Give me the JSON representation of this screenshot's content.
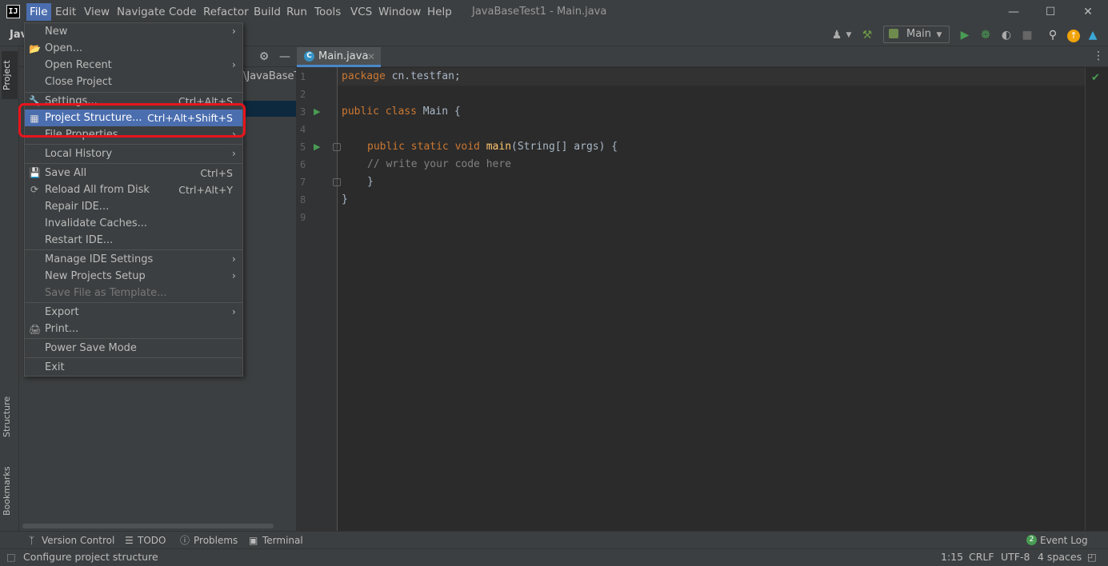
{
  "app": {
    "logo": "IJ",
    "window_title": "JavaBaseTest1 - Main.java"
  },
  "menubar": [
    {
      "label": "File"
    },
    {
      "label": "Edit"
    },
    {
      "label": "View"
    },
    {
      "label": "Navigate"
    },
    {
      "label": "Code"
    },
    {
      "label": "Refactor"
    },
    {
      "label": "Build"
    },
    {
      "label": "Run"
    },
    {
      "label": "Tools"
    },
    {
      "label": "VCS"
    },
    {
      "label": "Window"
    },
    {
      "label": "Help"
    }
  ],
  "window_controls": {
    "minimize": "—",
    "maximize": "☐",
    "close": "✕"
  },
  "toolbar": {
    "run_config": "Main"
  },
  "left_strip": {
    "project": "Project",
    "structure": "Structure",
    "bookmarks": "Bookmarks"
  },
  "project_panel": {
    "header_label": "Jav",
    "path_fragment": "\\JavaBaseT"
  },
  "editor": {
    "tab_label": "Main.java",
    "tab_icon": "C",
    "lines": [
      {
        "no": "1"
      },
      {
        "no": "2"
      },
      {
        "no": "3"
      },
      {
        "no": "4"
      },
      {
        "no": "5"
      },
      {
        "no": "6"
      },
      {
        "no": "7"
      },
      {
        "no": "8"
      },
      {
        "no": "9"
      }
    ],
    "code": {
      "l1_kw": "package",
      "l1_rest": " cn.testfan;",
      "l3_kw": "public class",
      "l3_rest": " Main {",
      "l5_kw": "public static void",
      "l5_fn": "main",
      "l5_rest": "(String[] args) {",
      "l6_comment": "// write your code here",
      "l7": "}",
      "l8": "}"
    }
  },
  "file_menu": {
    "new": "New",
    "open": "Open...",
    "open_recent": "Open Recent",
    "close_project": "Close Project",
    "settings": "Settings...",
    "settings_shortcut": "Ctrl+Alt+S",
    "project_structure": "Project Structure...",
    "project_structure_shortcut": "Ctrl+Alt+Shift+S",
    "file_properties": "File Properties",
    "local_history": "Local History",
    "save_all": "Save All",
    "save_all_shortcut": "Ctrl+S",
    "reload": "Reload All from Disk",
    "reload_shortcut": "Ctrl+Alt+Y",
    "repair": "Repair IDE...",
    "invalidate": "Invalidate Caches...",
    "restart": "Restart IDE...",
    "manage_settings": "Manage IDE Settings",
    "new_projects_setup": "New Projects Setup",
    "save_template": "Save File as Template...",
    "export": "Export",
    "print": "Print...",
    "power_save": "Power Save Mode",
    "exit": "Exit"
  },
  "bottom_tools": {
    "version_control": "Version Control",
    "todo": "TODO",
    "problems": "Problems",
    "terminal": "Terminal",
    "event_log": "Event Log",
    "event_count": "2"
  },
  "status": {
    "message": "Configure project structure",
    "position": "1:15",
    "line_sep": "CRLF",
    "encoding": "UTF-8",
    "indent": "4 spaces"
  },
  "colors": {
    "accent": "#4b6eaf",
    "highlight_box": "#e8141c",
    "run_green": "#499c54",
    "keyword": "#cc7832"
  }
}
